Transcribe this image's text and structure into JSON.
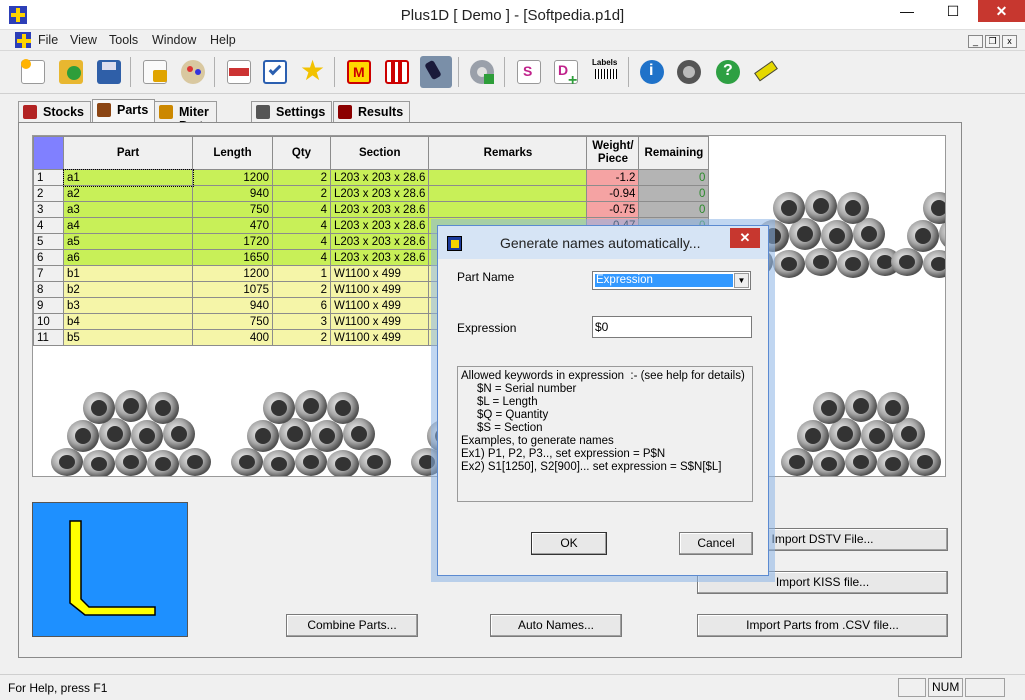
{
  "window": {
    "title": "Plus1D [ Demo ] - [Softpedia.p1d]",
    "minimize": "—",
    "maximize": "☐",
    "close": "✕"
  },
  "menu": [
    "File",
    "View",
    "Tools",
    "Window",
    "Help"
  ],
  "mdi_buttons": [
    "_",
    "❐",
    "x"
  ],
  "toolbar": {
    "labels_text": "Labels",
    "icons": [
      "new-icon",
      "open-icon",
      "save-icon",
      "lock-icon",
      "palette-icon",
      "rtf-icon",
      "checklist-icon",
      "star-icon",
      "miter-icon",
      "grid-icon",
      "paint-icon",
      "gear-icon",
      "s-doc-icon",
      "d-doc-icon",
      "labels-icon",
      "info-icon",
      "film-icon",
      "help-icon",
      "cut-icon"
    ]
  },
  "tabs": [
    {
      "label": "Stocks",
      "icon": "stocks-icon",
      "color": "#b22222"
    },
    {
      "label": "Parts",
      "icon": "parts-icon",
      "color": "#8b4513"
    },
    {
      "label": "Miter Parts",
      "icon": "miter-icon",
      "color": "#cc8800"
    },
    {
      "label": "Settings",
      "icon": "settings-icon",
      "color": "#555555"
    },
    {
      "label": "Results",
      "icon": "results-icon",
      "color": "#8b0000"
    }
  ],
  "grid": {
    "columns": [
      "Part",
      "Length",
      "Qty",
      "Section",
      "Remarks",
      "Weight/ Piece",
      "Remaining"
    ],
    "rows": [
      {
        "num": "1",
        "part": "a1",
        "length": "1200",
        "qty": "2",
        "section": "L203 x 203 x 28.6",
        "remarks": "",
        "weight": "-1.2",
        "remaining": "0"
      },
      {
        "num": "2",
        "part": "a2",
        "length": "940",
        "qty": "2",
        "section": "L203 x 203 x 28.6",
        "remarks": "",
        "weight": "-0.94",
        "remaining": "0"
      },
      {
        "num": "3",
        "part": "a3",
        "length": "750",
        "qty": "4",
        "section": "L203 x 203 x 28.6",
        "remarks": "",
        "weight": "-0.75",
        "remaining": "0"
      },
      {
        "num": "4",
        "part": "a4",
        "length": "470",
        "qty": "4",
        "section": "L203 x 203 x 28.6",
        "remarks": "",
        "weight": "-0.47",
        "remaining": "0"
      },
      {
        "num": "5",
        "part": "a5",
        "length": "1720",
        "qty": "4",
        "section": "L203 x 203 x 28.6",
        "remarks": "",
        "weight": "",
        "remaining": ""
      },
      {
        "num": "6",
        "part": "a6",
        "length": "1650",
        "qty": "4",
        "section": "L203 x 203 x 28.6",
        "remarks": "",
        "weight": "",
        "remaining": ""
      },
      {
        "num": "7",
        "part": "b1",
        "length": "1200",
        "qty": "1",
        "section": "W1100 x 499",
        "remarks": "",
        "weight": "",
        "remaining": ""
      },
      {
        "num": "8",
        "part": "b2",
        "length": "1075",
        "qty": "2",
        "section": "W1100 x 499",
        "remarks": "",
        "weight": "",
        "remaining": ""
      },
      {
        "num": "9",
        "part": "b3",
        "length": "940",
        "qty": "6",
        "section": "W1100 x 499",
        "remarks": "",
        "weight": "",
        "remaining": ""
      },
      {
        "num": "10",
        "part": "b4",
        "length": "750",
        "qty": "3",
        "section": "W1100 x 499",
        "remarks": "",
        "weight": "",
        "remaining": ""
      },
      {
        "num": "11",
        "part": "b5",
        "length": "400",
        "qty": "2",
        "section": "W1100 x 499",
        "remarks": "",
        "weight": "",
        "remaining": ""
      }
    ],
    "colors": {
      "a_rows": "#c8f058",
      "b_rows": "#f5f5a8",
      "weight": "#f5a3a3",
      "remaining": "#b4b4b4",
      "remaining_text": "#2c8a2c",
      "corner": "#8080ff"
    }
  },
  "buttons": {
    "combine": "Combine Parts...",
    "auto_names": "Auto Names...",
    "import_dstv": "Import DSTV File...",
    "import_kiss": "Import  KISS file...",
    "import_csv": "Import Parts from .CSV file..."
  },
  "preview": {
    "bg": "#1e90ff",
    "shape_color": "#ffff00"
  },
  "dialog": {
    "title": "Generate names automatically...",
    "close": "✕",
    "part_name_label": "Part Name",
    "part_name_value": "Expression",
    "expression_label": "Expression",
    "expression_value": "$0",
    "help_lines": [
      "Allowed keywords in expression  :- (see help for details)",
      "     $N = Serial number",
      "     $L = Length",
      "     $Q = Quantity",
      "     $S = Section",
      "Examples, to generate names",
      "Ex1) P1, P2, P3.., set expression = P$N",
      "Ex2) S1[1250], S2[900]... set expression = S$N[$L]"
    ],
    "ok": "OK",
    "cancel": "Cancel"
  },
  "status": {
    "help": "For Help, press F1",
    "num": "NUM"
  }
}
